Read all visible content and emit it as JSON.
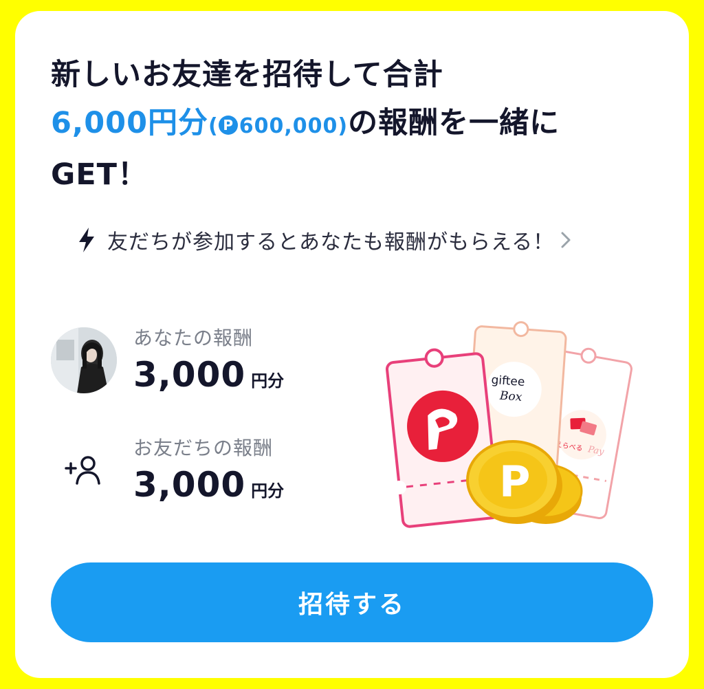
{
  "headline": {
    "line1": "新しいお友達を招待して合計",
    "amount": "6,000円分",
    "paren_open": "(",
    "points_badge": "P",
    "points": "600,000",
    "paren_close": ")",
    "line2_rest": "の報酬を一緒に",
    "line3": "GET！"
  },
  "info_link": {
    "icon": "lightning-bolt-icon",
    "text": "友だちが参加するとあなたも報酬がもらえる！",
    "chevron": "chevron-right-icon"
  },
  "rewards": {
    "you": {
      "label": "あなたの報酬",
      "value": "3,000",
      "unit": "円分"
    },
    "friend": {
      "icon": "add-friend-icon",
      "label": "お友だちの報酬",
      "value": "3,000",
      "unit": "円分"
    }
  },
  "illustration": {
    "giftee_title": "giftee",
    "giftee_subtitle": "Box",
    "erabera_text": "えらべる",
    "erabera_pay": "Pay",
    "coin_letter": "P"
  },
  "colors": {
    "background": "#FFFF00",
    "accent_blue": "#1E90E8",
    "button_blue": "#1A9CF2",
    "paypay_red": "#E8203A",
    "coin_gold": "#F5C518",
    "text_dark": "#14162B"
  },
  "invite_button": {
    "label": "招待する"
  }
}
